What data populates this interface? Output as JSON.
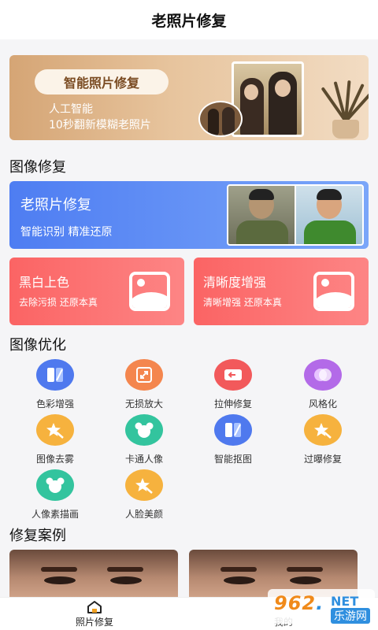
{
  "header": {
    "title": "老照片修复"
  },
  "banner": {
    "pill_label": "智能照片修复",
    "line1": "人工智能",
    "line2": "10秒翻新模糊老照片"
  },
  "sections": {
    "repair": "图像修复",
    "optimize": "图像优化",
    "cases": "修复案例"
  },
  "old_photo_card": {
    "title": "老照片修复",
    "subtitle": "智能识别  精准还原"
  },
  "colorize_card": {
    "title": "黑白上色",
    "subtitle": "去除污损  还原本真"
  },
  "clarity_card": {
    "title": "清晰度增强",
    "subtitle": "清晰增强  还原本真"
  },
  "tools": [
    {
      "label": "色彩增强",
      "icon": "color-enhance-icon",
      "color": "#4f79ee"
    },
    {
      "label": "无损放大",
      "icon": "enlarge-icon",
      "color": "#f4864e"
    },
    {
      "label": "拉伸修复",
      "icon": "stretch-repair-icon",
      "color": "#f2595b"
    },
    {
      "label": "风格化",
      "icon": "style-icon",
      "color": "#b36ae8"
    },
    {
      "label": "图像去雾",
      "icon": "magic-wand-icon",
      "color": "#f6b23e"
    },
    {
      "label": "卡通人像",
      "icon": "cartoon-face-icon",
      "color": "#33c49e"
    },
    {
      "label": "智能抠图",
      "icon": "cutout-icon",
      "color": "#4f79ee"
    },
    {
      "label": "过曝修复",
      "icon": "magic-wand-icon",
      "color": "#f6b23e"
    },
    {
      "label": "人像素描画",
      "icon": "cartoon-face-icon",
      "color": "#33c49e"
    },
    {
      "label": "人脸美颜",
      "icon": "magic-wand-icon",
      "color": "#f6b23e"
    }
  ],
  "tabbar": {
    "home_label": "照片修复",
    "mine_label": "我的"
  },
  "watermark": {
    "number": "962",
    "dot": ".",
    "net": "NET",
    "cn": "乐游网"
  },
  "colors": {
    "accent_blue": "#4f79ee",
    "accent_red": "#fb6464",
    "tab_active": "#f0a020"
  }
}
